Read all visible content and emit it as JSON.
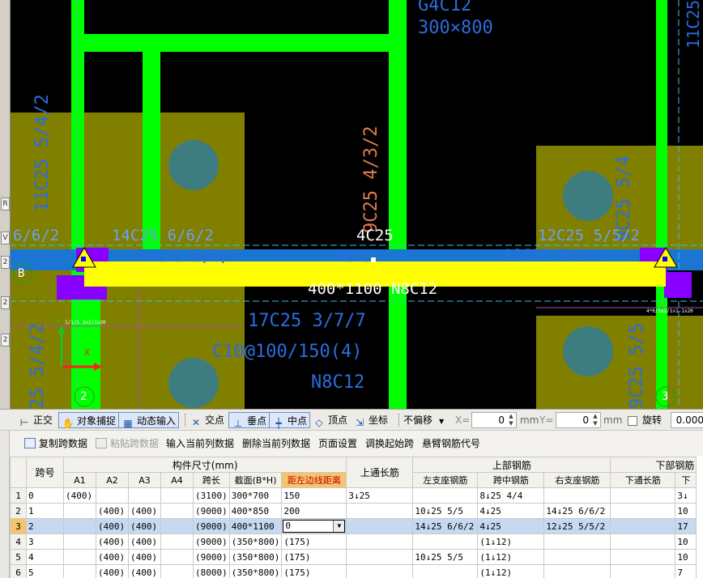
{
  "colors": {
    "beam": "#00ff00",
    "column_pad": "#807f00",
    "pile": "#3d7d80",
    "highlight_beam": "#ffff00",
    "axis_blue": "#2b6de0",
    "support_purple": "#8a00ff",
    "canvas_bg": "#000000",
    "selected_row": "#c5d9f1",
    "selected_rowhdr": "#f5c46c"
  },
  "cad": {
    "texts": {
      "beam_name_top": "G4C12",
      "beam_size_top": "300×800",
      "beam_right_vert": "11C25",
      "col_left_vert": "11C25 5/4/2",
      "rebar_mid_vert": "9C25 4/3/2",
      "rebar_right_vert": "9C25 5/4",
      "left_support": "6/6/2",
      "left_top_1": "14C25 6/6/2",
      "left_top_2": "14C25 6/6/2",
      "mid_top_white": "4C25",
      "mid_top_blue": "4C25",
      "right_top_1": "12C25 5/5/2",
      "right_top_2": "12C25 5/5/2",
      "beam_section": "400*1100 N8C12",
      "bottom_rebar": "17C25 3/7/7",
      "stirrup": "C10@100/150(4)",
      "waist": "N8C12",
      "left_bottom_vert": "25 5/4/2",
      "right_bottom_vert": "9C25 5/5",
      "axis_b": "B",
      "axis_2": "2",
      "axis_3": "3",
      "small_left": "1/1/1 2x2/1x20",
      "small_right": "4*0/1x2/1x1-1x20",
      "coord_y": "Y",
      "coord_x": "X"
    }
  },
  "left_strip": [
    "R",
    "V",
    "2",
    "2",
    "2"
  ],
  "snapbar": {
    "ortho": "正交",
    "snap": "对象捕捉",
    "dyninput": "动态输入",
    "intersect": "交点",
    "perp": "垂点",
    "mid": "中点",
    "vertex": "顶点",
    "coord": "坐标",
    "offset": "不偏移",
    "x_label": "X=",
    "x_value": "0",
    "unit_mm1": "mm",
    "y_label": "Y=",
    "y_value": "0",
    "unit_mm2": "mm",
    "rotate": "旋转",
    "rotate_value": "0.000"
  },
  "table_toolbar": {
    "copy_span": "复制跨数据",
    "paste_span": "粘贴跨数据",
    "input_col": "输入当前列数据",
    "delete_col": "删除当前列数据",
    "page_setup": "页面设置",
    "adjust_start": "调换起始跨",
    "cantilever": "悬臂钢筋代号"
  },
  "grid": {
    "headers": {
      "span_no": "跨号",
      "member_size": "构件尺寸(mm)",
      "a1": "A1",
      "a2": "A2",
      "a3": "A3",
      "a4": "A4",
      "span_len": "跨长",
      "section": "截面(B*H)",
      "dist_left": "距左边线距离",
      "top_through": "上通长筋",
      "top_rebar": "上部钢筋",
      "left_support": "左支座钢筋",
      "mid_span": "跨中钢筋",
      "right_support": "右支座钢筋",
      "bottom_rebar": "下部钢筋",
      "bottom_through": "下通长筋",
      "more": "下"
    },
    "rows": [
      {
        "n": "1",
        "span": "0",
        "a1": "(400)",
        "a2": "",
        "a3": "",
        "a4": "",
        "len": "(3100)",
        "sec": "300*700",
        "dist": "150",
        "top": "3↓25",
        "ls": "",
        "mid": "8↓25 4/4",
        "rs": "",
        "bt": "",
        "extra": "3↓"
      },
      {
        "n": "2",
        "span": "1",
        "a1": "",
        "a2": "(400)",
        "a3": "(400)",
        "a4": "",
        "len": "(9000)",
        "sec": "400*850",
        "dist": "200",
        "top": "",
        "ls": "10↓25 5/5",
        "mid": "4↓25",
        "rs": "14↓25 6/6/2",
        "bt": "",
        "extra": "10"
      },
      {
        "n": "3",
        "span": "2",
        "a1": "",
        "a2": "(400)",
        "a3": "(400)",
        "a4": "",
        "len": "(9000)",
        "sec": "400*1100",
        "dist": "0",
        "top": "",
        "ls": "14↓25 6/6/2",
        "mid": "4↓25",
        "rs": "12↓25 5/5/2",
        "bt": "",
        "extra": "17"
      },
      {
        "n": "4",
        "span": "3",
        "a1": "",
        "a2": "(400)",
        "a3": "(400)",
        "a4": "",
        "len": "(9000)",
        "sec": "(350*800)",
        "dist": "(175)",
        "top": "",
        "ls": "",
        "mid": "(1↓12)",
        "rs": "",
        "bt": "",
        "extra": "10"
      },
      {
        "n": "5",
        "span": "4",
        "a1": "",
        "a2": "(400)",
        "a3": "(400)",
        "a4": "",
        "len": "(9000)",
        "sec": "(350*800)",
        "dist": "(175)",
        "top": "",
        "ls": "10↓25 5/5",
        "mid": "(1↓12)",
        "rs": "",
        "bt": "",
        "extra": "10"
      },
      {
        "n": "6",
        "span": "5",
        "a1": "",
        "a2": "(400)",
        "a3": "(400)",
        "a4": "",
        "len": "(8000)",
        "sec": "(350*800)",
        "dist": "(175)",
        "top": "",
        "ls": "",
        "mid": "(1↓12)",
        "rs": "",
        "bt": "",
        "extra": "7"
      }
    ],
    "selected_row": 2
  }
}
